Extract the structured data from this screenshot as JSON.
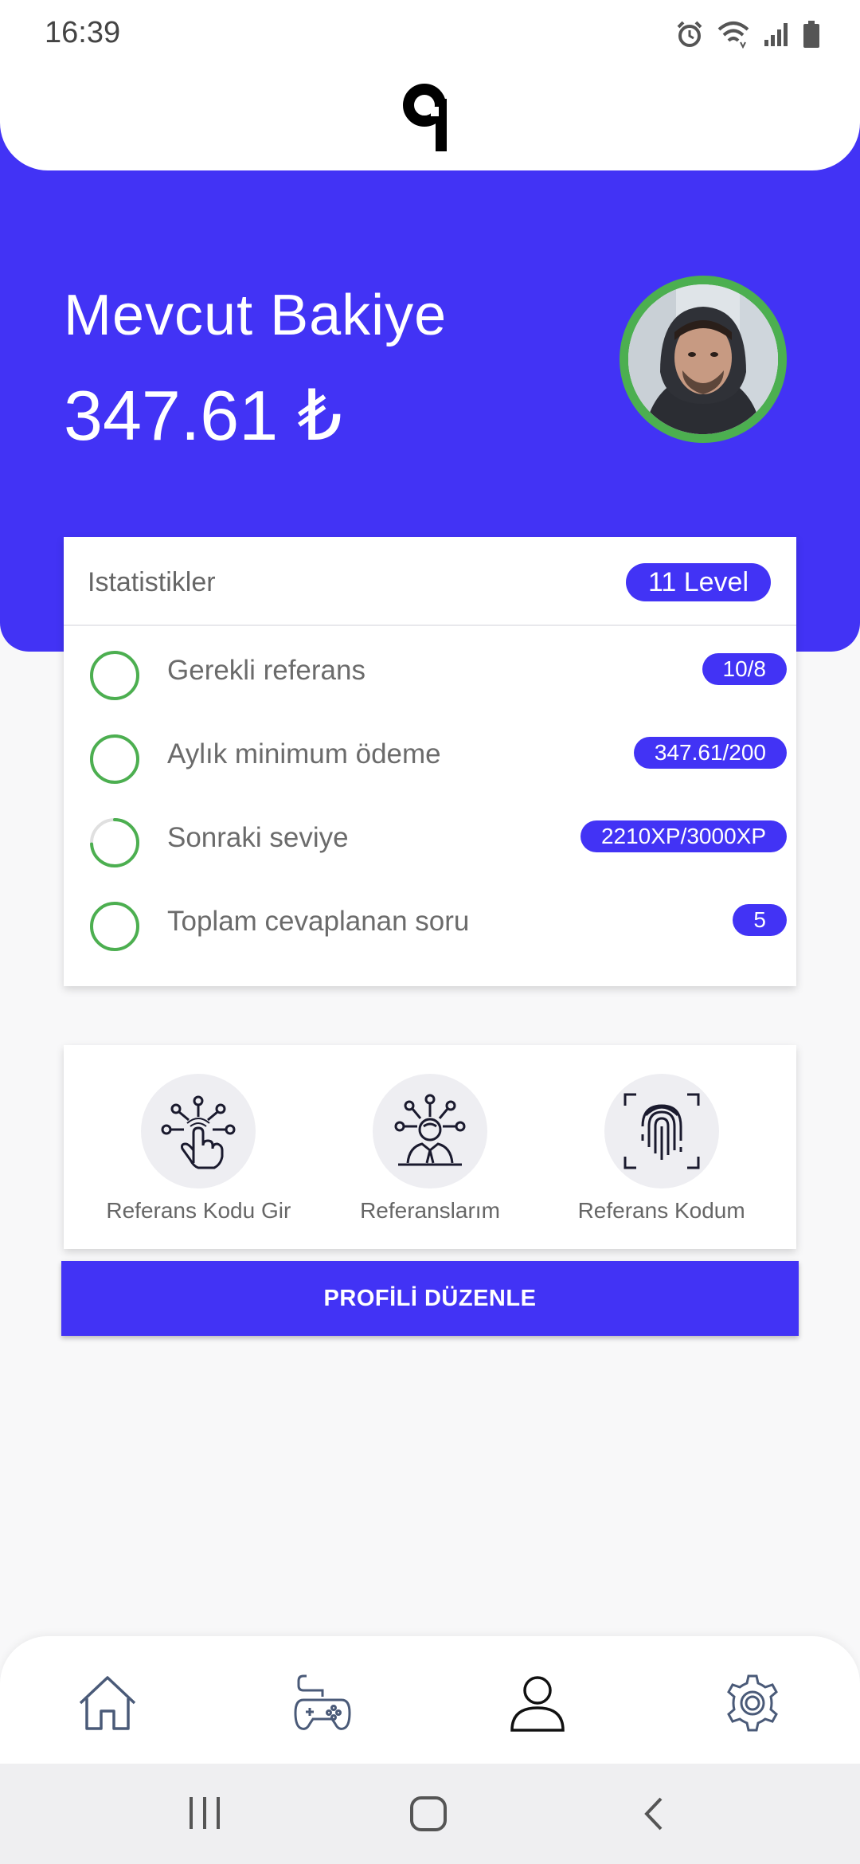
{
  "status_bar": {
    "time": "16:39"
  },
  "balance": {
    "label": "Mevcut Bakiye",
    "value": "347.61 ₺"
  },
  "stats": {
    "title": "Istatistikler",
    "level": "11 Level",
    "rows": [
      {
        "label": "Gerekli referans",
        "value": "10/8",
        "progress": 1.0
      },
      {
        "label": "Aylık minimum ödeme",
        "value": "347.61/200",
        "progress": 1.0
      },
      {
        "label": "Sonraki seviye",
        "value": "2210XP/3000XP",
        "progress": 0.74
      },
      {
        "label": "Toplam cevaplanan soru",
        "value": "5",
        "progress": 1.0
      }
    ]
  },
  "referral": {
    "items": [
      {
        "label": "Referans Kodu Gir",
        "icon": "touch-network-icon"
      },
      {
        "label": "Referanslarım",
        "icon": "person-network-icon"
      },
      {
        "label": "Referans Kodum",
        "icon": "fingerprint-icon"
      }
    ]
  },
  "edit_profile_button": "PROFİLİ DÜZENLE",
  "bottom_nav": {
    "items": [
      "home-icon",
      "gamepad-icon",
      "profile-icon",
      "settings-icon"
    ],
    "active": "profile-icon"
  },
  "colors": {
    "primary": "#4233f5",
    "success": "#4caf50",
    "avatar_ring": "#4caf50"
  }
}
